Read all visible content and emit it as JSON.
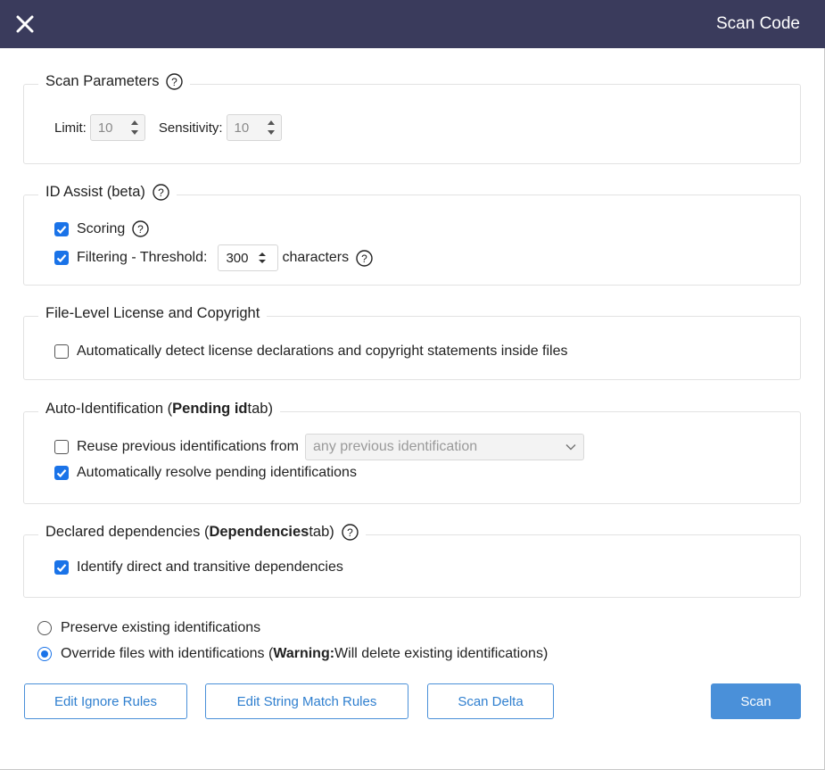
{
  "header": {
    "title": "Scan Code",
    "close_icon": "close-icon"
  },
  "scan_parameters": {
    "legend": "Scan Parameters",
    "limit_label": "Limit:",
    "limit_value": "10",
    "sensitivity_label": "Sensitivity:",
    "sensitivity_value": "10"
  },
  "id_assist": {
    "legend": "ID Assist (beta)",
    "scoring_label": "Scoring",
    "scoring_checked": true,
    "filtering_label": "Filtering - Threshold:",
    "filtering_checked": true,
    "threshold_value": "300",
    "threshold_unit": "characters"
  },
  "file_level": {
    "legend": "File-Level License and Copyright",
    "detect_label": "Automatically detect license declarations and copyright statements inside files",
    "detect_checked": false
  },
  "auto_identification": {
    "legend_prefix": "Auto-Identification (",
    "legend_bold": "Pending id",
    "legend_suffix": " tab)",
    "reuse_label": "Reuse previous identifications from",
    "reuse_checked": false,
    "reuse_select_value": "any previous identification",
    "resolve_label": "Automatically resolve pending identifications",
    "resolve_checked": true
  },
  "declared_dependencies": {
    "legend_prefix": "Declared dependencies (",
    "legend_bold": "Dependencies",
    "legend_suffix": " tab)",
    "identify_label": "Identify direct and transitive dependencies",
    "identify_checked": true
  },
  "identification_mode": {
    "preserve_label": "Preserve existing identifications",
    "preserve_selected": false,
    "override_prefix": "Override files with identifications (",
    "override_bold": "Warning:",
    "override_suffix": " Will delete existing identifications)",
    "override_selected": true
  },
  "buttons": {
    "edit_ignore_rules": "Edit Ignore Rules",
    "edit_string_match_rules": "Edit String Match Rules",
    "scan_delta": "Scan Delta",
    "scan": "Scan"
  },
  "colors": {
    "header_bg": "#3a3b5c",
    "accent": "#1a73e8",
    "button_primary": "#4a90d9"
  }
}
